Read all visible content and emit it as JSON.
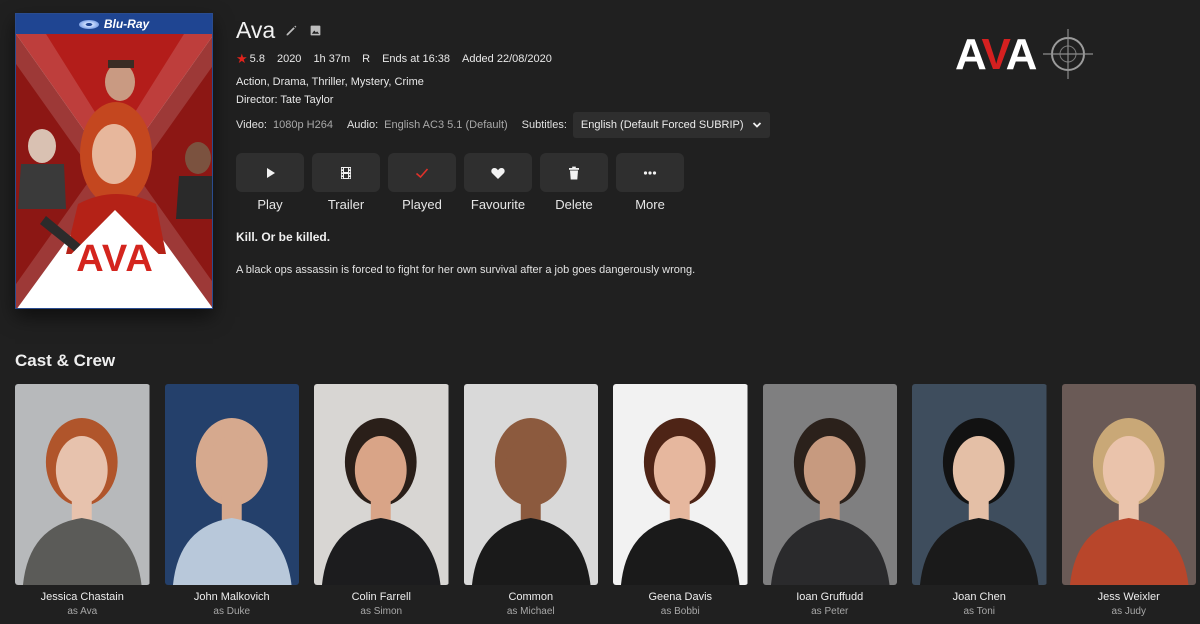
{
  "poster": {
    "badge": "Blu-Ray",
    "title_art": "AVA"
  },
  "title": "Ava",
  "meta": {
    "rating": "5.8",
    "year": "2020",
    "runtime": "1h 37m",
    "certification": "R",
    "ends_at": "Ends at 16:38",
    "added": "Added 22/08/2020"
  },
  "genres": "Action, Drama, Thriller, Mystery, Crime",
  "director": {
    "label": "Director:",
    "name": "Tate Taylor"
  },
  "streams": {
    "video_label": "Video:",
    "video_value": "1080p H264",
    "audio_label": "Audio:",
    "audio_value": "English AC3 5.1 (Default)",
    "subtitles_label": "Subtitles:",
    "subtitles_value": "English (Default Forced SUBRIP)"
  },
  "actions": [
    {
      "label": "Play",
      "icon": "play-icon"
    },
    {
      "label": "Trailer",
      "icon": "film-icon"
    },
    {
      "label": "Played",
      "icon": "check-icon"
    },
    {
      "label": "Favourite",
      "icon": "heart-icon"
    },
    {
      "label": "Delete",
      "icon": "trash-icon"
    },
    {
      "label": "More",
      "icon": "more-icon"
    }
  ],
  "tagline": "Kill. Or be killed.",
  "overview": "A black ops assassin is forced to fight for her own survival after a job goes dangerously wrong.",
  "logo": {
    "text_a1": "A",
    "text_v": "V",
    "text_a2": "A"
  },
  "cast_section_title": "Cast & Crew",
  "cast": [
    {
      "name": "Jessica Chastain",
      "role": "as Ava",
      "bg": "#b7b9bb",
      "skin": "#e7c2ad",
      "hair": "#b0552b",
      "cloth": "#5b5b58"
    },
    {
      "name": "John Malkovich",
      "role": "as Duke",
      "bg": "#24406b",
      "skin": "#d6a98e",
      "hair": "#d6a98e",
      "cloth": "#b8c8da"
    },
    {
      "name": "Colin Farrell",
      "role": "as Simon",
      "bg": "#d8d6d3",
      "skin": "#d9a487",
      "hair": "#2a1f19",
      "cloth": "#1c1c1e"
    },
    {
      "name": "Common",
      "role": "as Michael",
      "bg": "#d9d9d9",
      "skin": "#8c5a3e",
      "hair": "#8c5a3e",
      "cloth": "#1a1a1a"
    },
    {
      "name": "Geena Davis",
      "role": "as Bobbi",
      "bg": "#f2f2f2",
      "skin": "#e6b79e",
      "hair": "#4e2416",
      "cloth": "#1a1a1a"
    },
    {
      "name": "Ioan Gruffudd",
      "role": "as Peter",
      "bg": "#7f7f80",
      "skin": "#c79a7f",
      "hair": "#2b211b",
      "cloth": "#2a2a2c"
    },
    {
      "name": "Joan Chen",
      "role": "as Toni",
      "bg": "#3e4d5d",
      "skin": "#e4bfa6",
      "hair": "#121212",
      "cloth": "#1a1a1a"
    },
    {
      "name": "Jess Weixler",
      "role": "as Judy",
      "bg": "#6a5a56",
      "skin": "#eac3ab",
      "hair": "#c9a877",
      "cloth": "#b8462b"
    }
  ]
}
